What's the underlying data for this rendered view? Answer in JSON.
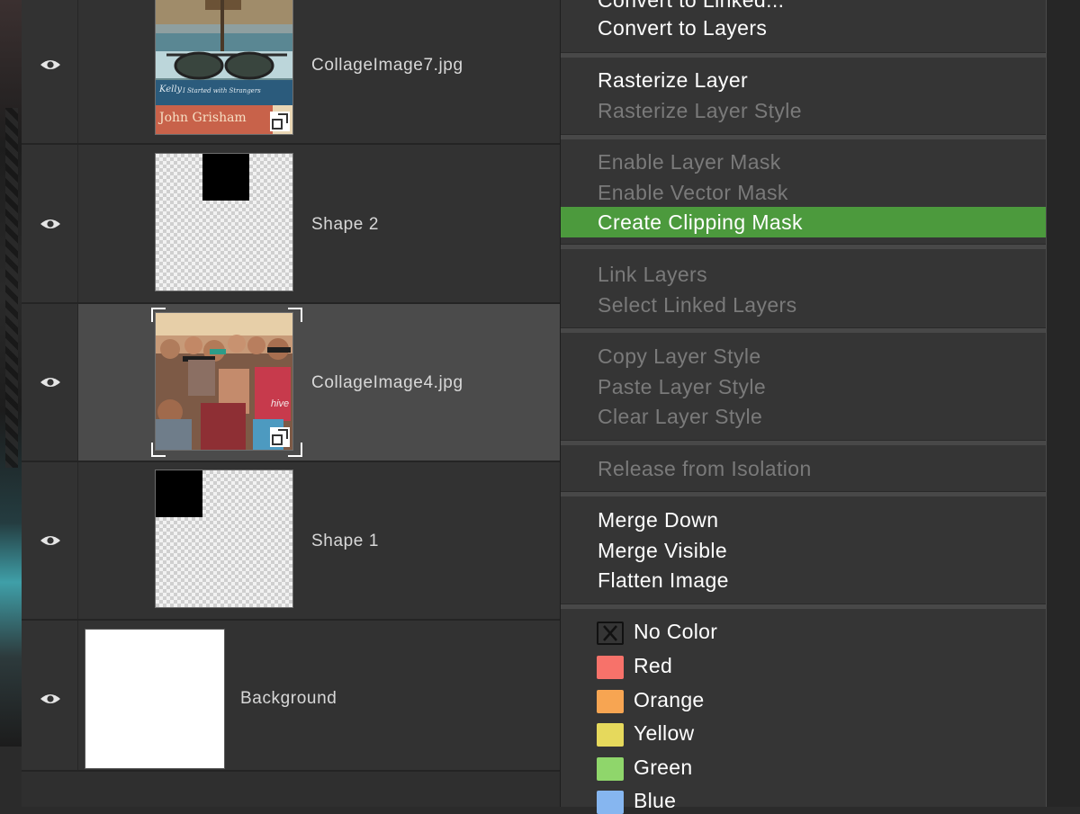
{
  "layers": [
    {
      "name": "CollageImage7.jpg"
    },
    {
      "name": "Shape 2"
    },
    {
      "name": "CollageImage4.jpg"
    },
    {
      "name": "Shape 1"
    },
    {
      "name": "Background"
    }
  ],
  "thumb_text": {
    "book1": "Kelly",
    "book1b": "I Started with Strangers",
    "book2": "John Grisham",
    "shirt": "hive"
  },
  "menu": {
    "convert_linked": "Convert to Linked...",
    "convert_layers": "Convert to Layers",
    "rasterize_layer": "Rasterize Layer",
    "rasterize_style": "Rasterize Layer Style",
    "enable_layer_mask": "Enable Layer Mask",
    "enable_vector_mask": "Enable Vector Mask",
    "create_clipping_mask": "Create Clipping Mask",
    "link_layers": "Link Layers",
    "select_linked": "Select Linked Layers",
    "copy_style": "Copy Layer Style",
    "paste_style": "Paste Layer Style",
    "clear_style": "Clear Layer Style",
    "release_isolation": "Release from Isolation",
    "merge_down": "Merge Down",
    "merge_visible": "Merge Visible",
    "flatten": "Flatten Image"
  },
  "colors": [
    {
      "label": "No Color",
      "hex": ""
    },
    {
      "label": "Red",
      "hex": "#f7726a"
    },
    {
      "label": "Orange",
      "hex": "#f7a552"
    },
    {
      "label": "Yellow",
      "hex": "#e6d95c"
    },
    {
      "label": "Green",
      "hex": "#8fd66b"
    },
    {
      "label": "Blue",
      "hex": "#86b6f0"
    }
  ],
  "theme": {
    "highlight": "#4c9a3d",
    "panel": "#323232",
    "selected_row": "#4b4b4b"
  }
}
